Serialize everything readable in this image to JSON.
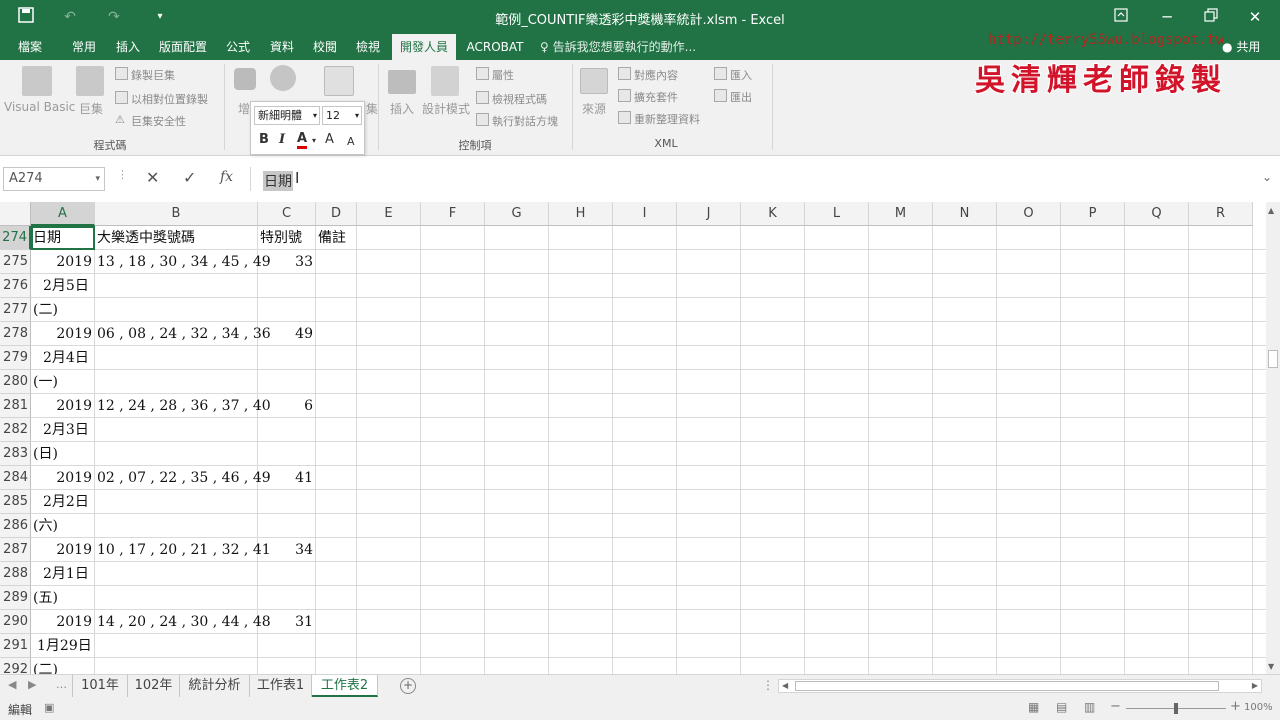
{
  "window": {
    "title": "範例_COUNTIF樂透彩中獎機率統計.xlsm - Excel"
  },
  "ribbon": {
    "tabs": [
      "檔案",
      "常用",
      "插入",
      "版面配置",
      "公式",
      "資料",
      "校閱",
      "檢視",
      "開發人員",
      "ACROBAT"
    ],
    "tell_me": "告訴我您想要執行的動作...",
    "share": "共用",
    "code_group": {
      "visual_basic": "Visual Basic",
      "macros": "巨集",
      "record_macro": "錄製巨集",
      "relative_refs": "以相對位置錄製",
      "macro_security": "巨集安全性",
      "label": "程式碼"
    },
    "addins_group": {
      "addins": "增益集",
      "partial_label": "集"
    },
    "controls_group": {
      "insert": "插入",
      "design_mode": "設計模式",
      "properties": "屬性",
      "view_code": "檢視程式碼",
      "run_dialog": "執行對話方塊",
      "label": "控制項"
    },
    "xml_group": {
      "source": "來源",
      "map_properties": "對應內容",
      "expansion_packs": "擴充套件",
      "refresh_data": "重新整理資料",
      "import": "匯入",
      "export": "匯出",
      "label": "XML"
    }
  },
  "mini_toolbar": {
    "font": "新細明體",
    "size": "12",
    "bold": "B",
    "italic": "I",
    "font_color": "A",
    "grow": "A",
    "shrink": "A"
  },
  "watermark": {
    "url": "http://terry55wu.blogspot.tw",
    "author": "吳清輝老師錄製"
  },
  "formula_bar": {
    "name_box": "A274",
    "cancel": "✕",
    "enter": "✓",
    "fx": "fx",
    "content": "日期"
  },
  "grid": {
    "columns": [
      "A",
      "B",
      "C",
      "D",
      "E",
      "F",
      "G",
      "H",
      "I",
      "J",
      "K",
      "L",
      "M",
      "N",
      "O",
      "P",
      "Q",
      "R"
    ],
    "row_numbers": [
      "274",
      "275",
      "276",
      "277",
      "278",
      "279",
      "280",
      "281",
      "282",
      "283",
      "284",
      "285",
      "286",
      "287",
      "288",
      "289",
      "290",
      "291",
      "292"
    ],
    "rows": [
      {
        "a": "日期",
        "b": "大樂透中獎號碼",
        "c": "特別號",
        "d": "備註"
      },
      {
        "a": "2019",
        "b": "13 , 18 , 30 , 34 , 45 , 49",
        "c": "33",
        "d": ""
      },
      {
        "a": "2月5日",
        "b": "",
        "c": "",
        "d": ""
      },
      {
        "a": "(二)",
        "b": "",
        "c": "",
        "d": ""
      },
      {
        "a": "2019",
        "b": "06 , 08 , 24 , 32 , 34 , 36",
        "c": "49",
        "d": ""
      },
      {
        "a": "2月4日",
        "b": "",
        "c": "",
        "d": ""
      },
      {
        "a": "(一)",
        "b": "",
        "c": "",
        "d": ""
      },
      {
        "a": "2019",
        "b": "12 , 24 , 28 , 36 , 37 , 40",
        "c": "6",
        "d": ""
      },
      {
        "a": "2月3日",
        "b": "",
        "c": "",
        "d": ""
      },
      {
        "a": "(日)",
        "b": "",
        "c": "",
        "d": ""
      },
      {
        "a": "2019",
        "b": "02 , 07 , 22 , 35 , 46 , 49",
        "c": "41",
        "d": ""
      },
      {
        "a": "2月2日",
        "b": "",
        "c": "",
        "d": ""
      },
      {
        "a": "(六)",
        "b": "",
        "c": "",
        "d": ""
      },
      {
        "a": "2019",
        "b": "10 , 17 , 20 , 21 , 32 , 41",
        "c": "34",
        "d": ""
      },
      {
        "a": "2月1日",
        "b": "",
        "c": "",
        "d": ""
      },
      {
        "a": "(五)",
        "b": "",
        "c": "",
        "d": ""
      },
      {
        "a": "2019",
        "b": "14 , 20 , 24 , 30 , 44 , 48",
        "c": "31",
        "d": ""
      },
      {
        "a": "1月29日",
        "b": "",
        "c": "",
        "d": ""
      },
      {
        "a": "(二)",
        "b": "",
        "c": "",
        "d": ""
      }
    ]
  },
  "sheets": {
    "tabs": [
      "101年",
      "102年",
      "統計分析",
      "工作表1",
      "工作表2"
    ],
    "active": "工作表2"
  },
  "status_bar": {
    "mode": "編輯",
    "zoom": "100%"
  },
  "colors": {
    "excel_green": "#217346",
    "watermark_red": "#d2142a"
  }
}
